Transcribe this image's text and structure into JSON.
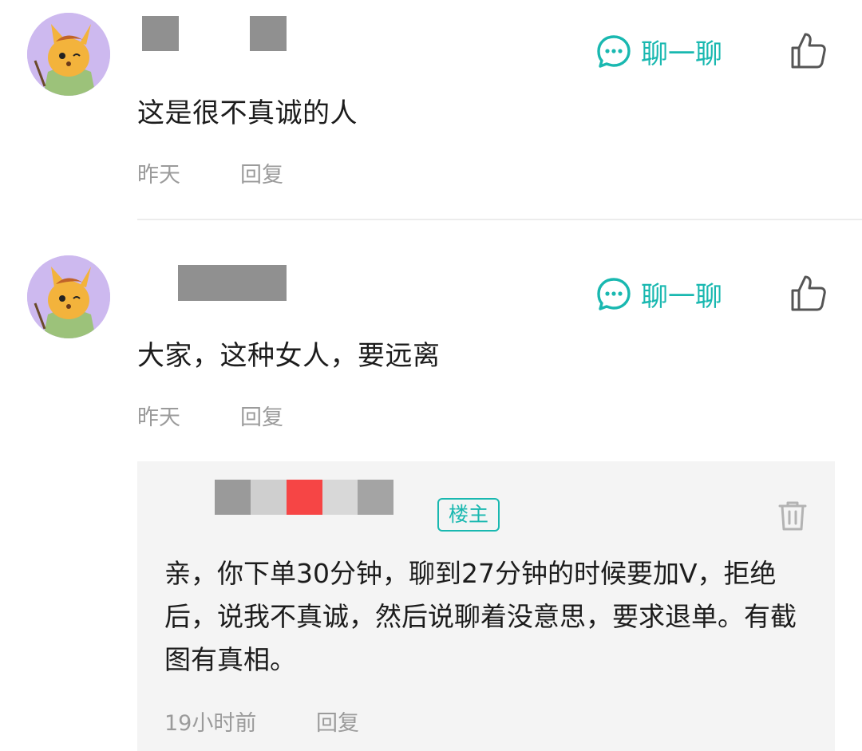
{
  "comments": [
    {
      "text": "这是很不真诚的人",
      "time": "昨天",
      "reply_label": "回复",
      "chat_label": "聊一聊"
    },
    {
      "text": "大家，这种女人，要远离",
      "time": "昨天",
      "reply_label": "回复",
      "chat_label": "聊一聊"
    }
  ],
  "reply": {
    "badge": "楼主",
    "text": "亲，你下单30分钟，聊到27分钟的时候要加V，拒绝后，说我不真诚，然后说聊着没意思，要求退单。有截图有真相。",
    "time": "19小时前",
    "reply_label": "回复"
  },
  "colors": {
    "accent": "#19b8b0",
    "avatar_bg": "#cdb9ef",
    "meta_text": "#9b9b9b",
    "redaction_gray": "#909090",
    "redaction_red": "#f64545"
  },
  "icons": [
    "avatar-mascot",
    "chat-bubble-icon",
    "thumbs-up-icon",
    "trash-icon"
  ]
}
